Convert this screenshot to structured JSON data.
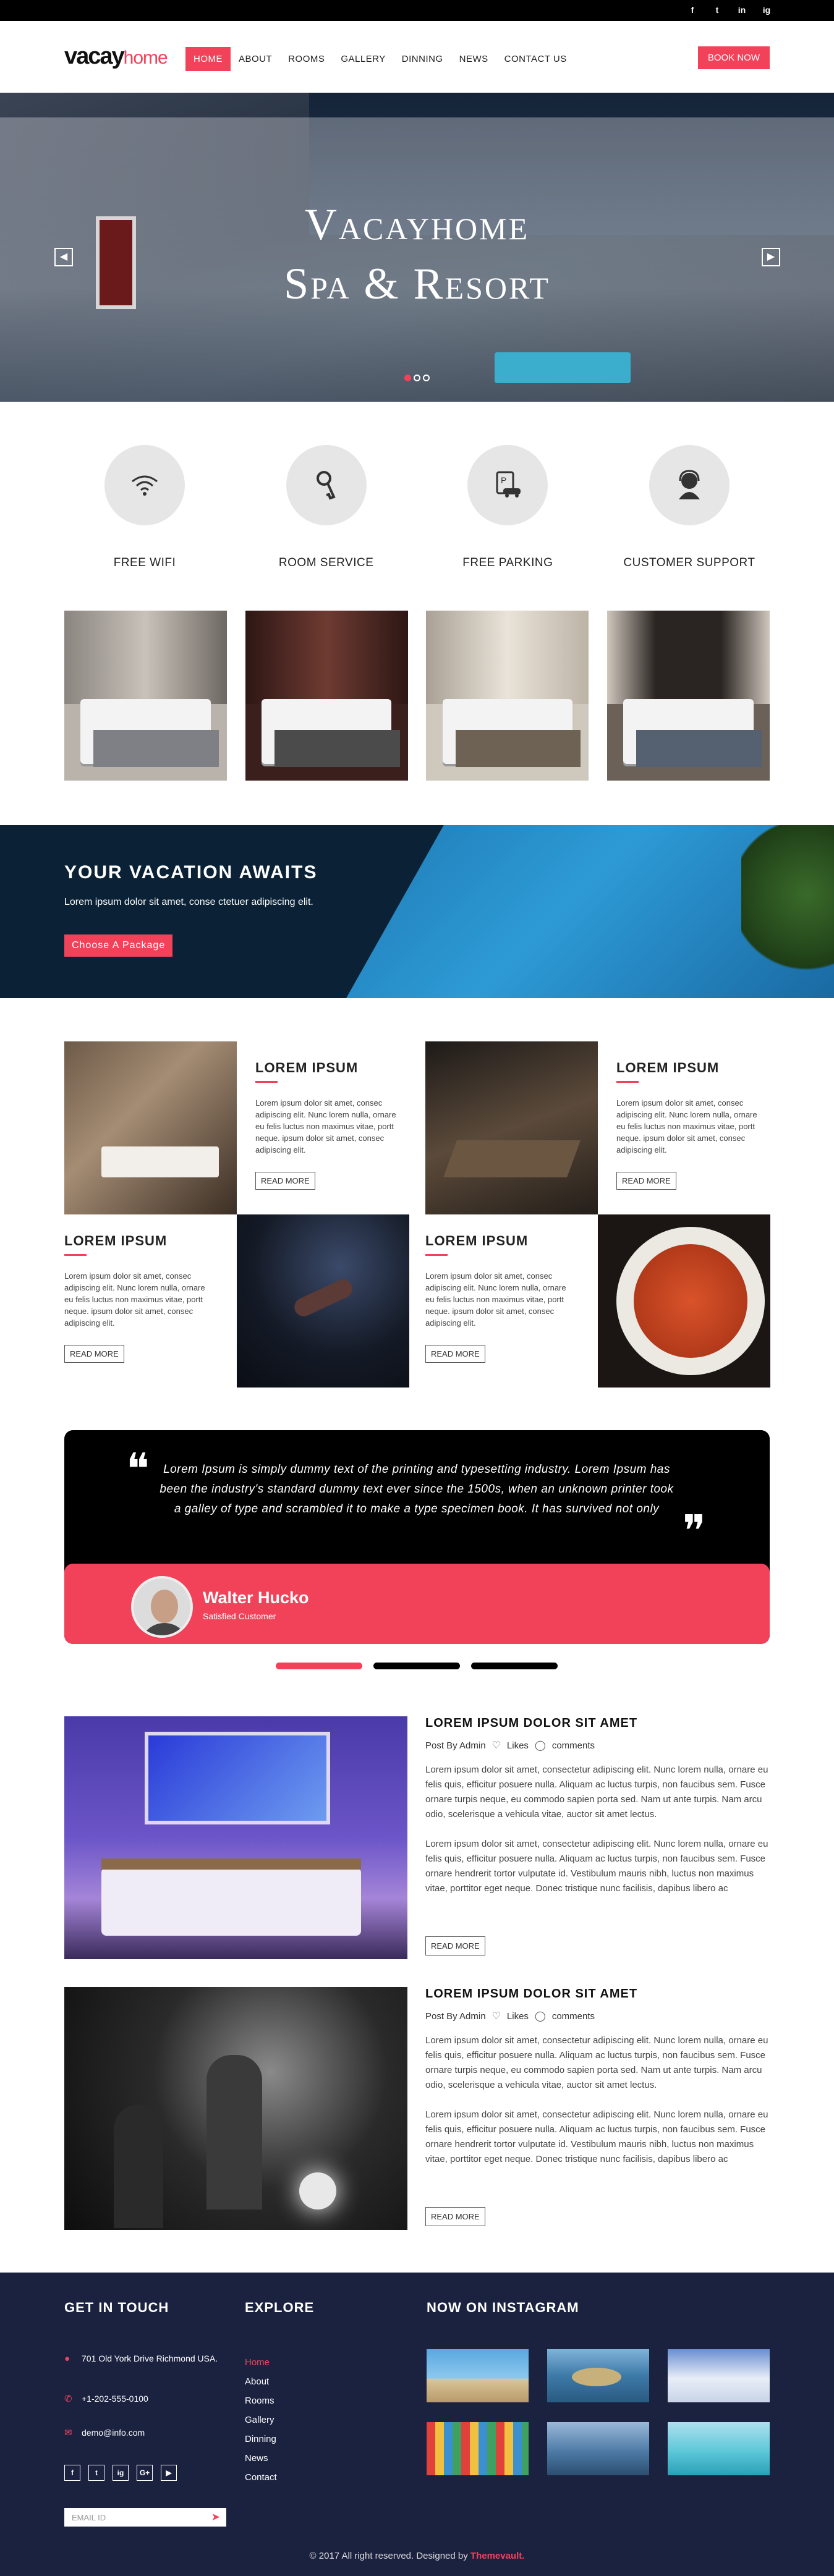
{
  "topbar": {
    "social": [
      "f",
      "t",
      "in",
      "ig"
    ]
  },
  "header": {
    "logo_a": "vacay",
    "logo_b": "home",
    "nav": [
      "HOME",
      "ABOUT",
      "ROOMS",
      "GALLERY",
      "DINNING",
      "NEWS",
      "CONTACT US"
    ],
    "book": "BOOK NOW"
  },
  "hero": {
    "line1": "Vacayhome",
    "line2": "Spa & Resort",
    "prev": "◀",
    "next": "▶",
    "slides": 3,
    "active_slide": 1
  },
  "features": [
    {
      "icon": "wifi-icon",
      "glyph": "((·))",
      "label": "FREE WIFI"
    },
    {
      "icon": "key-icon",
      "glyph": "⚷",
      "label": "ROOM SERVICE"
    },
    {
      "icon": "car-icon",
      "glyph": "🚗",
      "label": "FREE PARKING"
    },
    {
      "icon": "support-icon",
      "glyph": "☺",
      "label": "CUSTOMER SUPPORT"
    }
  ],
  "vacation": {
    "title": "YOUR VACATION AWAITS",
    "text": "Lorem ipsum dolor sit amet, conse ctetuer adipiscing elit.",
    "button": "Choose A Package"
  },
  "cards": [
    {
      "title": "LOREM IPSUM",
      "text": "Lorem ipsum dolor sit amet, consec adipiscing elit. Nunc lorem nulla, ornare eu felis luctus non maximus vitae, portt neque. ipsum dolor sit amet, consec adipiscing elit.",
      "button": "READ MORE"
    },
    {
      "title": "LOREM IPSUM",
      "text": "Lorem ipsum dolor sit amet, consec adipiscing elit. Nunc lorem nulla, ornare eu felis luctus non maximus vitae, portt neque. ipsum dolor sit amet, consec adipiscing elit.",
      "button": "READ MORE"
    },
    {
      "title": "LOREM IPSUM",
      "text": "Lorem ipsum dolor sit amet, consec adipiscing elit. Nunc lorem nulla, ornare eu felis luctus non maximus vitae, portt neque. ipsum dolor sit amet, consec adipiscing elit.",
      "button": "READ MORE"
    },
    {
      "title": "LOREM IPSUM",
      "text": "Lorem ipsum dolor sit amet, consec adipiscing elit. Nunc lorem nulla, ornare eu felis luctus non maximus vitae, portt neque. ipsum dolor sit amet, consec adipiscing elit.",
      "button": "READ MORE"
    }
  ],
  "testimonial": {
    "open_quote": "❝",
    "close_quote": "❞",
    "quote": "Lorem Ipsum is simply dummy text of the printing and typesetting industry. Lorem Ipsum has been the industry's standard dummy text ever since the 1500s, when an unknown printer took a galley of type and scrambled it to make a type specimen book. It has survived not only",
    "name": "Walter Hucko",
    "role": "Satisfied Customer",
    "pages": 3,
    "active_page": 1
  },
  "posts": [
    {
      "title": "LOREM IPSUM DOLOR SIT AMET",
      "author": "Post By Admin",
      "likes": "Likes",
      "comments": "comments",
      "p1": "Lorem ipsum dolor sit amet, consectetur adipiscing elit. Nunc lorem nulla, ornare eu felis quis, efficitur posuere nulla. Aliquam ac luctus turpis, non faucibus sem. Fusce ornare turpis neque, eu commodo sapien porta sed. Nam ut ante turpis. Nam arcu odio, scelerisque a vehicula vitae, auctor sit amet lectus.",
      "p2": "Lorem ipsum dolor sit amet, consectetur adipiscing elit. Nunc lorem nulla, ornare eu felis quis, efficitur posuere nulla. Aliquam ac luctus turpis, non faucibus sem. Fusce ornare hendrerit tortor vulputate id. Vestibulum mauris nibh, luctus non maximus vitae, porttitor eget neque. Donec tristique nunc facilisis, dapibus libero ac",
      "button": "READ MORE"
    },
    {
      "title": "LOREM IPSUM DOLOR SIT AMET",
      "author": "Post By Admin",
      "likes": "Likes",
      "comments": "comments",
      "p1": "Lorem ipsum dolor sit amet, consectetur adipiscing elit. Nunc lorem nulla, ornare eu felis quis, efficitur posuere nulla. Aliquam ac luctus turpis, non faucibus sem. Fusce ornare turpis neque, eu commodo sapien porta sed. Nam ut ante turpis. Nam arcu odio, scelerisque a vehicula vitae, auctor sit amet lectus.",
      "p2": "Lorem ipsum dolor sit amet, consectetur adipiscing elit. Nunc lorem nulla, ornare eu felis quis, efficitur posuere nulla. Aliquam ac luctus turpis, non faucibus sem. Fusce ornare hendrerit tortor vulputate id. Vestibulum mauris nibh, luctus non maximus vitae, porttitor eget neque. Donec tristique nunc facilisis, dapibus libero ac",
      "button": "READ MORE"
    }
  ],
  "footer": {
    "contact_title": "GET IN TOUCH",
    "address": "701 Old York Drive Richmond USA.",
    "phone": "+1-202-555-0100",
    "email": "demo@info.com",
    "social": [
      "f",
      "t",
      "ig",
      "G+",
      "▶"
    ],
    "email_placeholder": "EMAIL ID",
    "explore_title": "EXPLORE",
    "explore": [
      "Home",
      "About",
      "Rooms",
      "Gallery",
      "Dinning",
      "News",
      "Contact"
    ],
    "insta_title": "NOW ON INSTAGRAM",
    "copyright": "© 2017 All right reserved. Designed by",
    "brand": "Themevault."
  },
  "colors": {
    "accent": "#f2425a",
    "footer_bg": "#1b2240",
    "dark": "#000000"
  }
}
